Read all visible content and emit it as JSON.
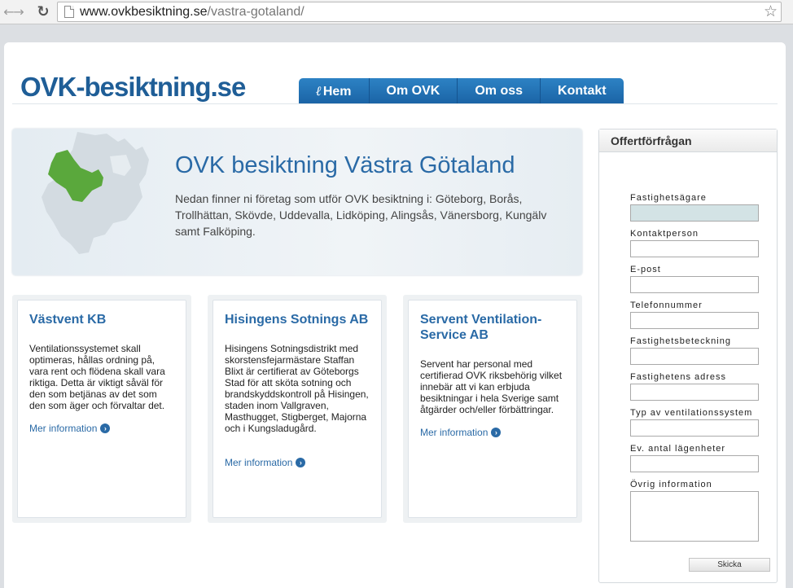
{
  "browser": {
    "url_host": "www.ovkbesiktning.se",
    "url_path": "/vastra-gotaland/"
  },
  "site": {
    "logo_text": "OVK-besiktning.se"
  },
  "nav": [
    {
      "label": "Hem",
      "glyph": "ℓ"
    },
    {
      "label": "Om OVK"
    },
    {
      "label": "Om oss"
    },
    {
      "label": "Kontakt"
    }
  ],
  "hero": {
    "title": "OVK besiktning Västra Götaland",
    "text": "Nedan finner ni företag som utför OVK besiktning i: Göteborg, Borås, Trollhättan, Skövde, Uddevalla, Lidköping, Alingsås, Vänersborg, Kungälv samt Falköping.",
    "highlight_color": "#5aa83c"
  },
  "cards": [
    {
      "title": "Västvent KB",
      "text": "Ventilationssystemet skall optimeras, hållas ordning på, vara rent och flödena skall vara riktiga. Detta är viktigt såväl för den som betjänas av det som den som äger och förvaltar det.",
      "link": "Mer information"
    },
    {
      "title": "Hisingens Sotnings AB",
      "text": "Hisingens Sotningsdistrikt med skorstensfejarmästare Staffan Blixt är certifierat av Göteborgs Stad för att sköta sotning och brandskyddskontroll på Hisingen, staden inom Vallgraven, Masthugget, Stigberget, Majorna och i Kungsladugård.",
      "link": "Mer information"
    },
    {
      "title": "Servent Ventilation-Service AB",
      "text": "Servent har personal med certifierad OVK riksbehörig vilket innebär att vi kan erbjuda besiktningar i hela Sverige samt åtgärder och/eller förbättringar.",
      "link": "Mer information"
    }
  ],
  "form": {
    "title": "Offertförfrågan",
    "fields": [
      {
        "label": "Fastighetsägare",
        "value": ""
      },
      {
        "label": "Kontaktperson",
        "value": ""
      },
      {
        "label": "E-post",
        "value": ""
      },
      {
        "label": "Telefonnummer",
        "value": ""
      },
      {
        "label": "Fastighetsbeteckning",
        "value": ""
      },
      {
        "label": "Fastighetens adress",
        "value": ""
      },
      {
        "label": "Typ av ventilationssystem",
        "value": ""
      },
      {
        "label": "Ev. antal lägenheter",
        "value": ""
      },
      {
        "label": "Övrig information",
        "value": ""
      }
    ],
    "submit_label": "Skicka"
  }
}
